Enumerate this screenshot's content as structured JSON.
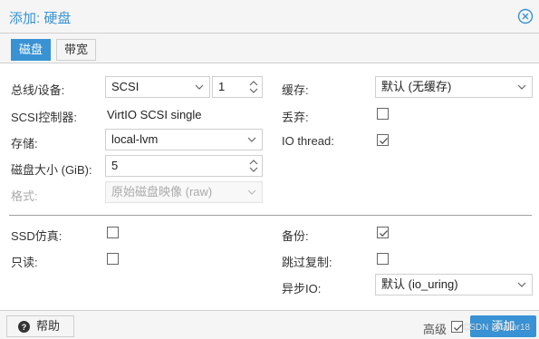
{
  "dialog": {
    "title": "添加: 硬盘"
  },
  "tabs": [
    {
      "label": "磁盘",
      "active": true
    },
    {
      "label": "带宽",
      "active": false
    }
  ],
  "left": {
    "bus_label": "总线/设备:",
    "bus_value": "SCSI",
    "device_value": "1",
    "controller_label": "SCSI控制器:",
    "controller_value": "VirtIO SCSI single",
    "storage_label": "存储:",
    "storage_value": "local-lvm",
    "size_label": "磁盘大小 (GiB):",
    "size_value": "5",
    "format_label": "格式:",
    "format_value": "原始磁盘映像 (raw)"
  },
  "right": {
    "cache_label": "缓存:",
    "cache_value": "默认 (无缓存)",
    "discard_label": "丢弃:",
    "discard_checked": false,
    "iothread_label": "IO thread:",
    "iothread_checked": true
  },
  "lower_left": {
    "ssd_label": "SSD仿真:",
    "ssd_checked": false,
    "readonly_label": "只读:",
    "readonly_checked": false
  },
  "lower_right": {
    "backup_label": "备份:",
    "backup_checked": true,
    "skip_replication_label": "跳过复制:",
    "skip_replication_checked": false,
    "async_io_label": "异步IO:",
    "async_io_value": "默认 (io_uring)"
  },
  "footer": {
    "help_label": "帮助",
    "advanced_label": "高级",
    "advanced_checked": true,
    "add_label": "添加",
    "watermark": "CSDN @tailor18"
  },
  "colors": {
    "accent": "#3892d4",
    "border": "#cfcfcf",
    "disabled_text": "#aaaaaa"
  }
}
